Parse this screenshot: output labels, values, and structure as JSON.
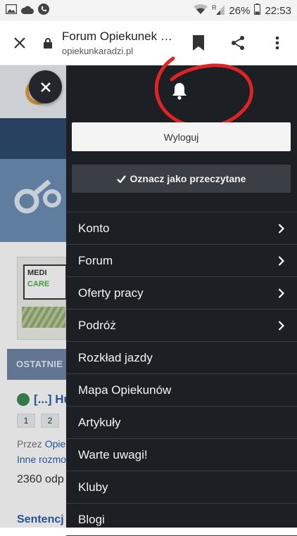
{
  "statusbar": {
    "battery_percent": "26%",
    "time": "22:53",
    "network_label": "R",
    "left_icons": [
      "gallery-icon",
      "cloud-icon",
      "phone-icon"
    ],
    "right_icons": [
      "wifi-icon",
      "signal-icon",
      "battery-icon"
    ]
  },
  "browser": {
    "title": "Forum Opiekunek o...",
    "url": "opiekunkaradzi.pl",
    "icons": [
      "close-icon",
      "lock-icon",
      "bookmark-icon",
      "share-icon",
      "more-vert-icon"
    ]
  },
  "background_page": {
    "ad_line1": "MEDI",
    "ad_line2": "CARE",
    "tab_label": "OSTATNIE",
    "topic_title": "[...] Hu",
    "pages": [
      "1",
      "2"
    ],
    "by_prefix": "Przez",
    "by_author": "Opie",
    "other_link": "Inne rozmo",
    "reply_count": "2360 odp",
    "next_topic": "Sentencj"
  },
  "menu": {
    "logout_label": "Wyloguj",
    "mark_read_label": "Oznacz jako przeczytane",
    "items": [
      {
        "label": "Konto",
        "has_submenu": true
      },
      {
        "label": "Forum",
        "has_submenu": true
      },
      {
        "label": "Oferty pracy",
        "has_submenu": true
      },
      {
        "label": "Podróż",
        "has_submenu": true
      },
      {
        "label": "Rozkład jazdy",
        "has_submenu": false
      },
      {
        "label": "Mapa Opiekunów",
        "has_submenu": false
      },
      {
        "label": "Artykuły",
        "has_submenu": false
      },
      {
        "label": "Warte uwagi!",
        "has_submenu": false
      },
      {
        "label": "Kluby",
        "has_submenu": false
      },
      {
        "label": "Blogi",
        "has_submenu": false
      }
    ]
  },
  "colors": {
    "menu_bg": "#1c1f24",
    "annotation_red": "#e02323",
    "link_blue": "#2b5fa8"
  }
}
